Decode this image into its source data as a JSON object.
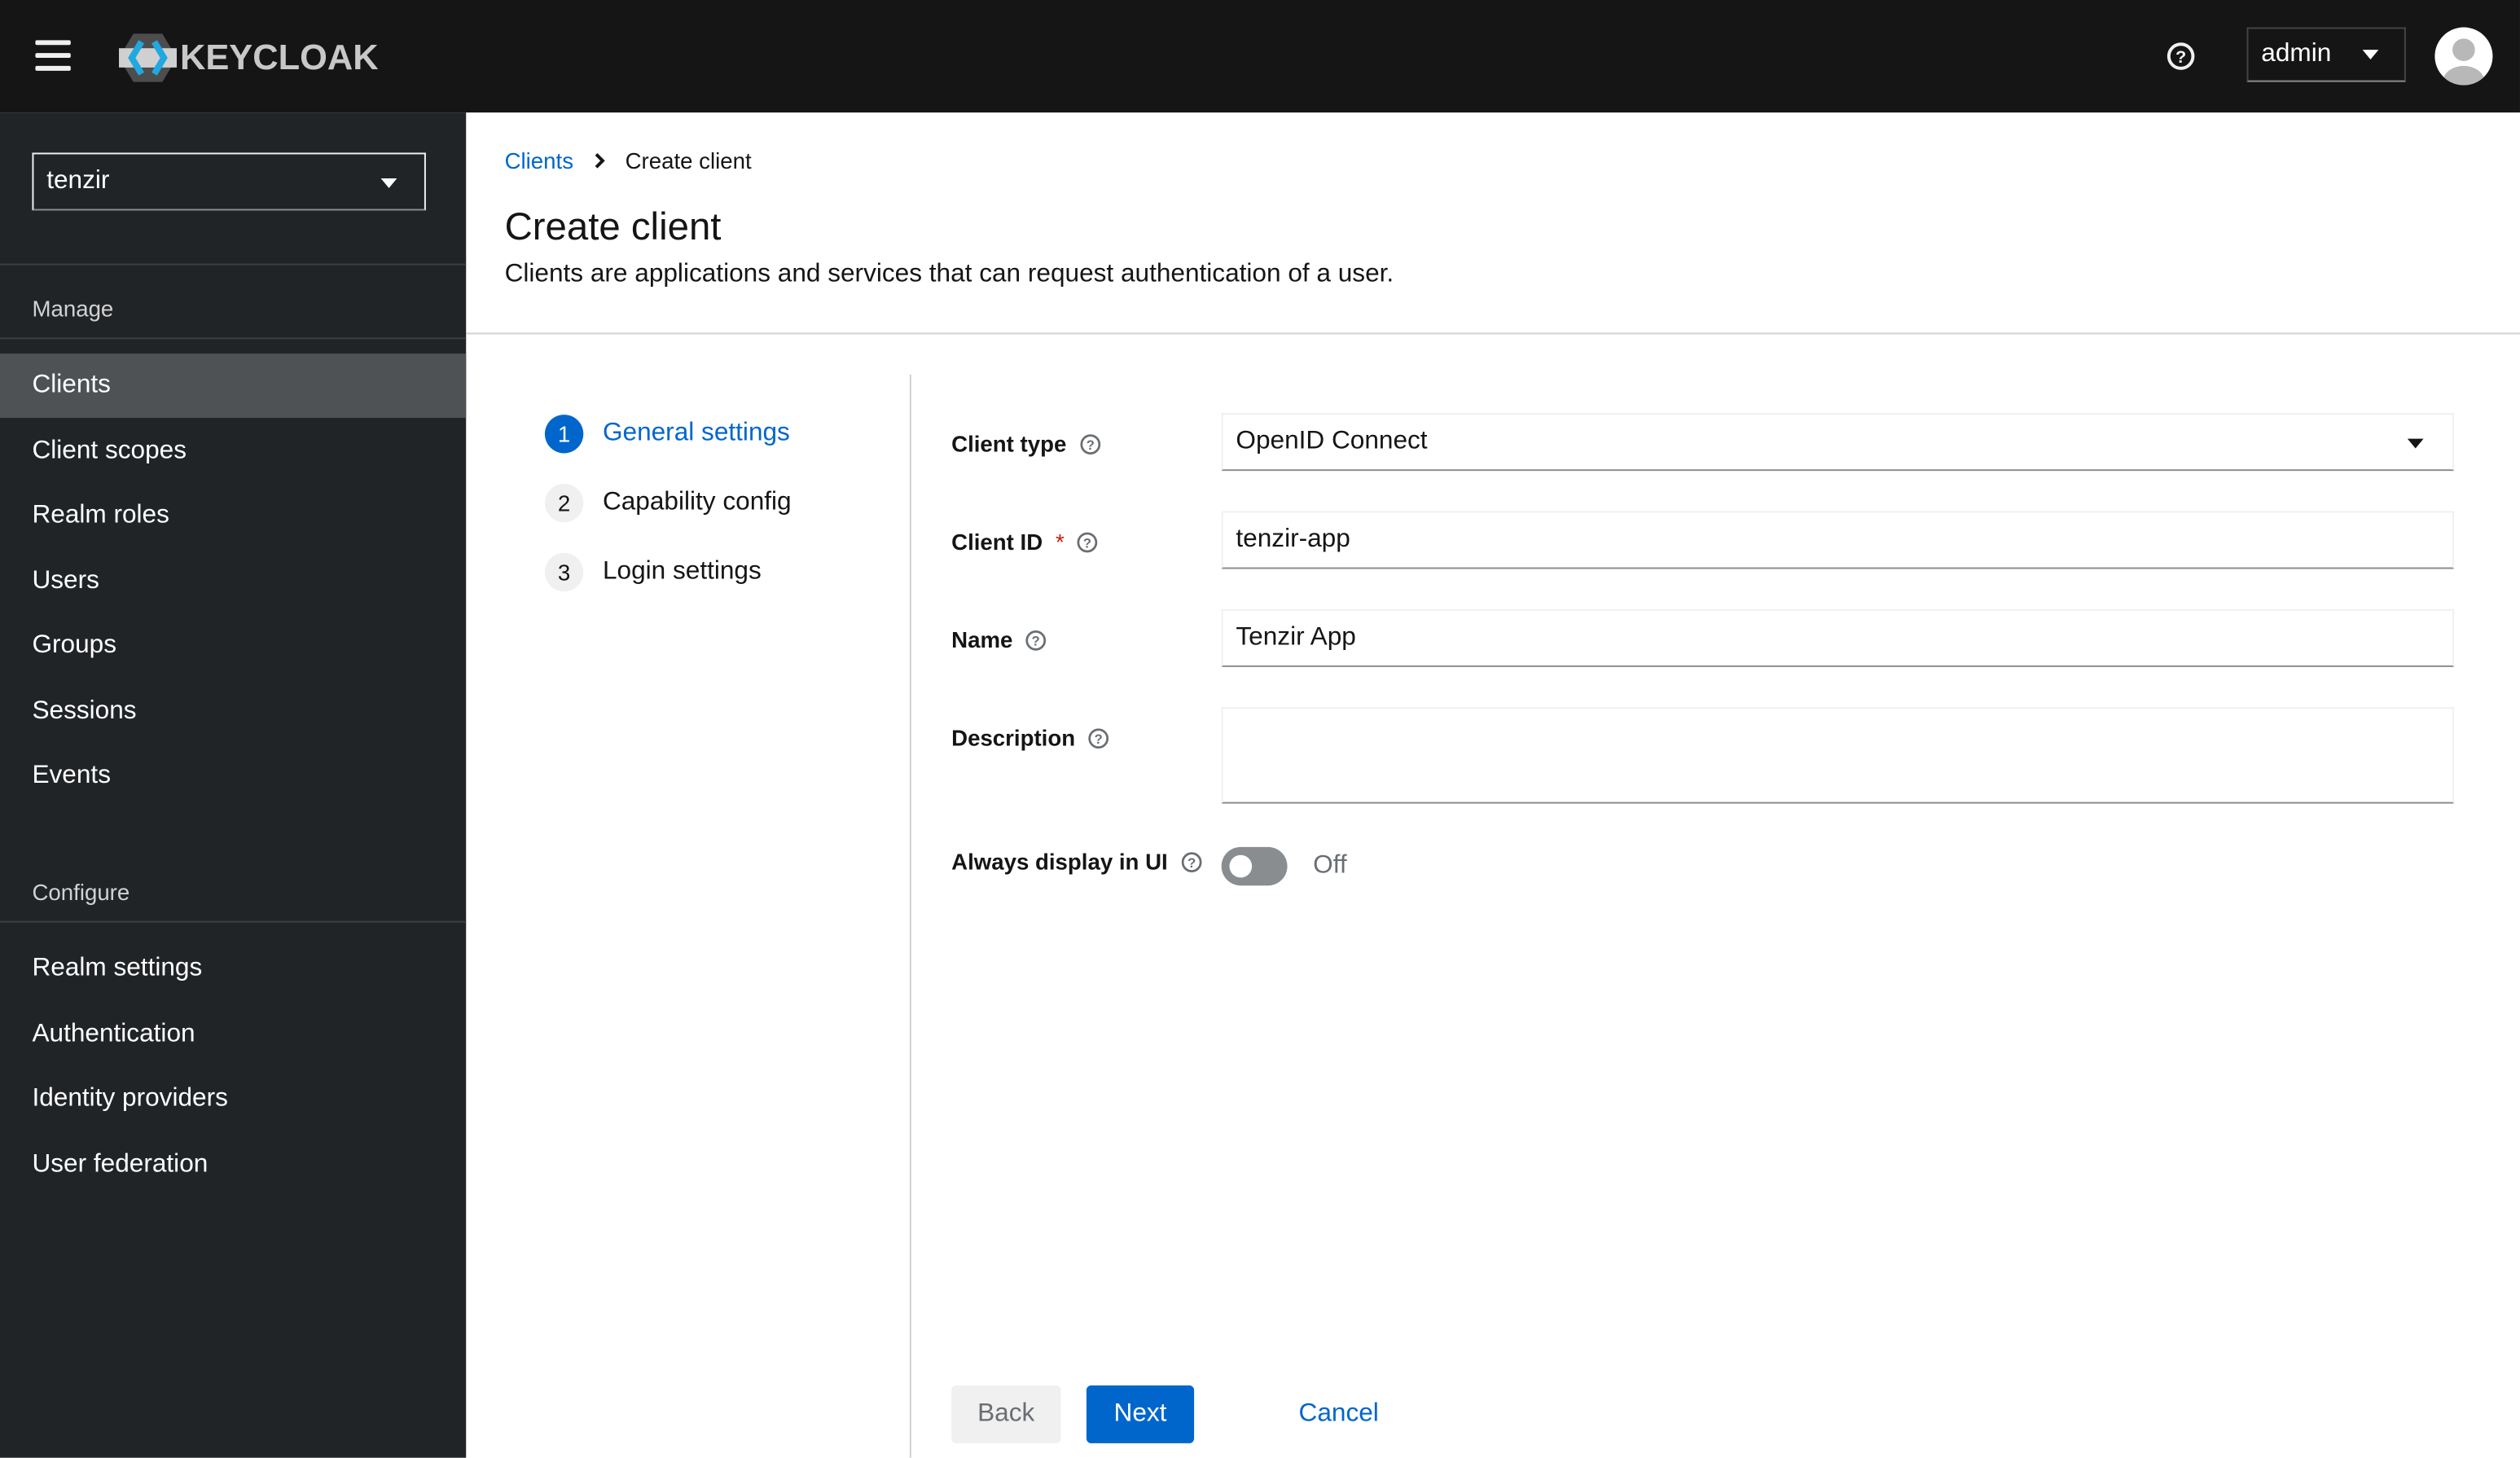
{
  "header": {
    "brand": "KEYCLOAK",
    "user": "admin",
    "icons": [
      "menu-icon",
      "help-icon",
      "caret-down-icon",
      "avatar-icon"
    ]
  },
  "sidebar": {
    "realm": "tenzir",
    "sections": [
      {
        "title": "Manage",
        "items": [
          {
            "label": "Clients",
            "active": true
          },
          {
            "label": "Client scopes"
          },
          {
            "label": "Realm roles"
          },
          {
            "label": "Users"
          },
          {
            "label": "Groups"
          },
          {
            "label": "Sessions"
          },
          {
            "label": "Events"
          }
        ]
      },
      {
        "title": "Configure",
        "items": [
          {
            "label": "Realm settings"
          },
          {
            "label": "Authentication"
          },
          {
            "label": "Identity providers"
          },
          {
            "label": "User federation"
          }
        ]
      }
    ]
  },
  "breadcrumb": {
    "parent": "Clients",
    "current": "Create client"
  },
  "page": {
    "title": "Create client",
    "description": "Clients are applications and services that can request authentication of a user."
  },
  "wizard": {
    "steps": [
      {
        "num": "1",
        "label": "General settings",
        "current": true
      },
      {
        "num": "2",
        "label": "Capability config"
      },
      {
        "num": "3",
        "label": "Login settings"
      }
    ]
  },
  "form": {
    "client_type": {
      "label": "Client type",
      "value": "OpenID Connect"
    },
    "client_id": {
      "label": "Client ID",
      "required": "*",
      "value": "tenzir-app"
    },
    "name": {
      "label": "Name",
      "value": "Tenzir App"
    },
    "description": {
      "label": "Description",
      "value": ""
    },
    "always_display": {
      "label": "Always display in UI",
      "state": "Off"
    }
  },
  "actions": {
    "back": "Back",
    "next": "Next",
    "cancel": "Cancel"
  },
  "colors": {
    "primary": "#0066cc",
    "header": "#151515",
    "sidebar": "#212427",
    "sidebar_active": "#4f5255"
  }
}
